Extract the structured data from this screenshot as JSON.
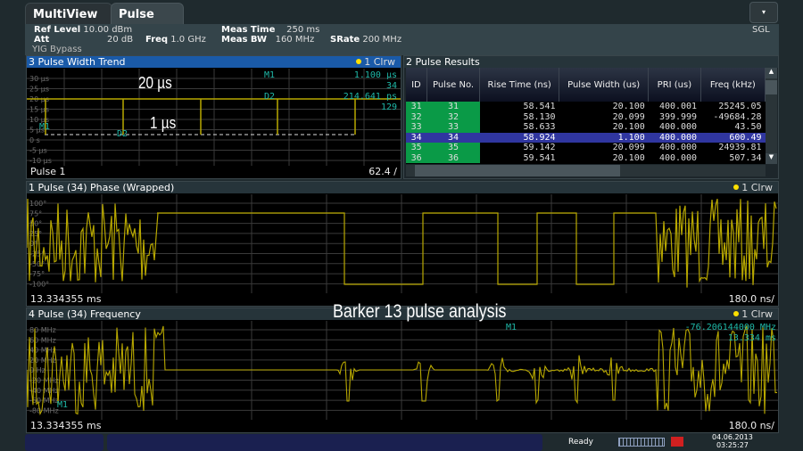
{
  "tabs": [
    {
      "label": "MultiView",
      "icon": "grid-icon"
    },
    {
      "label": "Pulse"
    }
  ],
  "menu_button_icon": "chevron-down-icon",
  "settings": {
    "ref_level_label": "Ref Level",
    "ref_level": "10.00 dBm",
    "att_label": "Att",
    "att": "20 dB",
    "freq_label": "Freq",
    "freq": "1.0 GHz",
    "meas_time_label": "Meas Time",
    "meas_time": "250 ms",
    "meas_bw_label": "Meas BW",
    "meas_bw": "160 MHz",
    "srate_label": "SRate",
    "srate": "200 MHz",
    "yig": "YIG Bypass",
    "mode": "SGL"
  },
  "trend": {
    "title": "3 Pulse Width Trend",
    "trace": "1 Clrw",
    "yticks": [
      "30 µs",
      "25 µs",
      "20 µs",
      "15 µs",
      "10 µs",
      "5 µs",
      "0 s",
      "-5 µs",
      "-10 µs"
    ],
    "m1_label": "M1",
    "m1_value": "1.100 µs",
    "m1_index": "34",
    "d2_label": "D2",
    "d2_value": "214.641 ps",
    "d2_index": "129",
    "marker_m1": "M1",
    "marker_d2": "D2",
    "annot_top": "20 µs",
    "annot_bottom": "1 µs",
    "footer_left": "Pulse 1",
    "footer_right": "62.4 /",
    "trace_color": "#b8a800"
  },
  "results": {
    "title": "2 Pulse Results",
    "columns": [
      "ID",
      "Pulse No.",
      "Rise Time (ns)",
      "Pulse Width (us)",
      "PRI (us)",
      "Freq (kHz)"
    ],
    "rows": [
      [
        "31",
        "31",
        "58.541",
        "20.100",
        "400.001",
        "25245.05"
      ],
      [
        "32",
        "32",
        "58.130",
        "20.099",
        "399.999",
        "-49684.28"
      ],
      [
        "33",
        "33",
        "58.633",
        "20.100",
        "400.000",
        "43.50"
      ],
      [
        "34",
        "34",
        "58.924",
        "1.100",
        "400.000",
        "600.49"
      ],
      [
        "35",
        "35",
        "59.142",
        "20.099",
        "400.000",
        "24939.81"
      ],
      [
        "36",
        "36",
        "59.541",
        "20.100",
        "400.000",
        "507.34"
      ]
    ],
    "selected_row": 3
  },
  "phase": {
    "title": "1 Pulse (34) Phase (Wrapped)",
    "trace": "1 Clrw",
    "yticks": [
      "100°",
      "75°",
      "50°",
      "25°",
      "0°",
      "-25°",
      "-50°",
      "-75°",
      "-100°"
    ],
    "footer_left": "13.334355 ms",
    "footer_right": "180.0 ns/"
  },
  "frequency": {
    "title": "4 Pulse (34) Frequency",
    "trace": "1 Clrw",
    "yticks": [
      "80 MHz",
      "60 MHz",
      "40 MHz",
      "20 MHz",
      "0 Hz",
      "-20 MHz",
      "-40 MHz",
      "-60 MHz",
      "-80 MHz"
    ],
    "m1_label": "M1",
    "m1_value": "-76.206144000 MHz",
    "m1_time": "13.334 ms",
    "marker_m1": "M1",
    "footer_left": "13.334355 ms",
    "footer_right": "180.0 ns/"
  },
  "caption": "Barker 13 pulse analysis",
  "status": {
    "state": "Ready",
    "date": "04.06.2013",
    "time": "03:25:27"
  }
}
